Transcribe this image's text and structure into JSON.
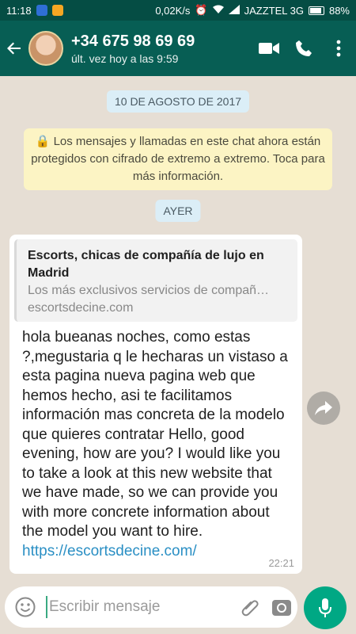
{
  "status_bar": {
    "time": "11:18",
    "network_speed": "0,02K/s",
    "carrier": "JAZZTEL 3G",
    "battery": "88%"
  },
  "header": {
    "contact_name": "+34 675 98 69 69",
    "last_seen": "últ. vez hoy a las 9:59",
    "icons": [
      "back-arrow-icon",
      "video-call-icon",
      "phone-icon",
      "more-vert-icon"
    ]
  },
  "chat": {
    "date_chip": "10 DE AGOSTO DE 2017",
    "encryption_notice": "🔒 Los mensajes y llamadas en este chat ahora están protegidos con cifrado de extremo a extremo. Toca para más información.",
    "day_chip": "AYER",
    "message": {
      "link_preview": {
        "title": "Escorts, chicas de compañía de lujo en Madrid",
        "description": "Los más exclusivos servicios de compañ…",
        "domain": "escortsdecine.com"
      },
      "text": "hola bueanas noches, como estas ?,megustaria q le hecharas un vistaso a esta pagina nueva pagina web que hemos hecho,  asi te facilitamos información mas concreta de la modelo que quieres contratar Hello, good evening, how are you? I would like you to take a look at this new website that we have made, so we can provide you with more concrete information about the model you want to hire. ",
      "link": "https://escortsdecine.com/",
      "time": "22:21"
    }
  },
  "input": {
    "placeholder": "Escribir mensaje"
  },
  "colors": {
    "header": "#075e54",
    "statusbar": "#054d44",
    "accent": "#00a884",
    "chat_bg": "#e6ded4",
    "encryption_bg": "#fcf4c4",
    "date_chip_bg": "#dbeef7",
    "link": "#2a8fc4"
  }
}
